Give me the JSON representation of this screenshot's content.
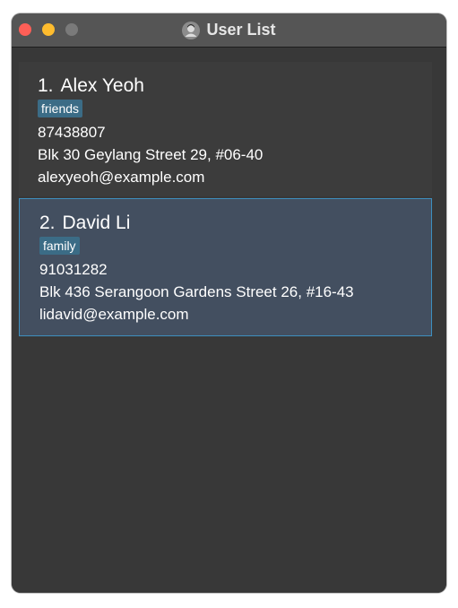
{
  "window": {
    "title": "User List",
    "title_icon": "user-avatar-icon"
  },
  "colors": {
    "close": "#ff5f57",
    "minimize": "#febc2e",
    "maximize": "#7a7a7a",
    "background": "#383838",
    "selected_card": "#434f60",
    "selected_border": "#3e8fbf",
    "tag": "#3b6c86"
  },
  "persons": [
    {
      "index": "1.",
      "name": "Alex Yeoh",
      "tag": "friends",
      "phone": "87438807",
      "address": "Blk 30 Geylang Street 29, #06-40",
      "email": "alexyeoh@example.com",
      "selected": false
    },
    {
      "index": "2.",
      "name": "David Li",
      "tag": "family",
      "phone": "91031282",
      "address": "Blk 436 Serangoon Gardens Street 26, #16-43",
      "email": "lidavid@example.com",
      "selected": true
    }
  ]
}
